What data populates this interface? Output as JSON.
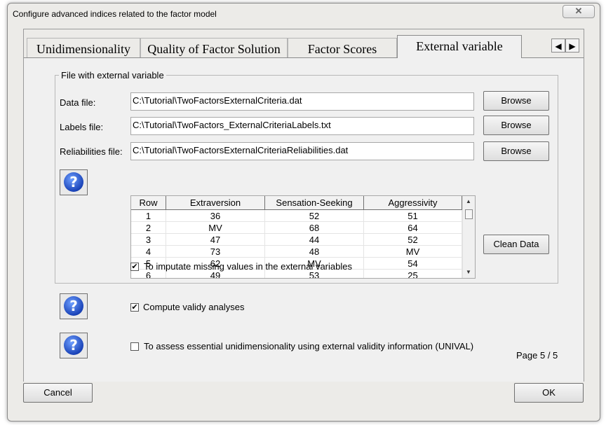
{
  "window": {
    "title": "Configure advanced indices related to the factor model",
    "close_glyph": "✕"
  },
  "tabs": [
    {
      "label": "Unidimensionality",
      "active": false
    },
    {
      "label": "Quality of Factor Solution",
      "active": false
    },
    {
      "label": "Factor Scores",
      "active": false
    },
    {
      "label": "External variable",
      "active": true
    }
  ],
  "tab_arrows": {
    "left": "◀",
    "right": "▶"
  },
  "group": {
    "label": "File with external variable"
  },
  "fields": {
    "data_file": {
      "label": "Data file:",
      "value": "C:\\Tutorial\\TwoFactorsExternalCriteria.dat",
      "button": "Browse"
    },
    "labels_file": {
      "label": "Labels file:",
      "value": "C:\\Tutorial\\TwoFactors_ExternalCriteriaLabels.txt",
      "button": "Browse"
    },
    "reliabilities_file": {
      "label": "Reliabilities file:",
      "value": "C:\\Tutorial\\TwoFactorsExternalCriteriaReliabilities.dat",
      "button": "Browse"
    }
  },
  "help": {
    "glyph": "?",
    "icon": "help-icon"
  },
  "table": {
    "columns": [
      "Row",
      "Extraversion",
      "Sensation-Seeking",
      "Aggressivity"
    ],
    "rows": [
      [
        "1",
        "36",
        "52",
        "51"
      ],
      [
        "2",
        "MV",
        "68",
        "64"
      ],
      [
        "3",
        "47",
        "44",
        "52"
      ],
      [
        "4",
        "73",
        "48",
        "MV"
      ],
      [
        "5",
        "62",
        "MV",
        "54"
      ],
      [
        "6",
        "49",
        "53",
        "25"
      ]
    ],
    "scroll_up": "▲",
    "scroll_down": "▼"
  },
  "clean_data_button": "Clean Data",
  "options": {
    "impute": {
      "label": "To imputate missing values in the external variables",
      "checked": true,
      "mark": "✔"
    },
    "validity": {
      "label": "Compute validy analyses",
      "checked": true,
      "mark": "✔"
    },
    "unival": {
      "label": "To assess essential unidimensionality using external validity information (UNIVAL)",
      "checked": false,
      "mark": ""
    }
  },
  "page_indicator": "Page 5 / 5",
  "footer": {
    "cancel": "Cancel",
    "ok": "OK"
  }
}
